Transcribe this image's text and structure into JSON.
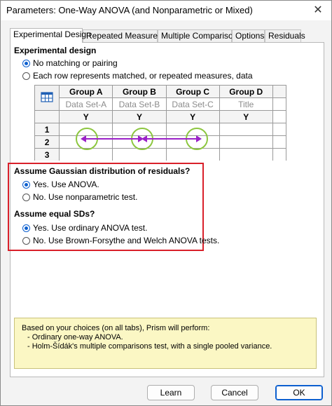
{
  "window": {
    "title": "Parameters: One-Way ANOVA (and Nonparametric or Mixed)"
  },
  "tabs": [
    {
      "label": "Experimental Design"
    },
    {
      "label": "Repeated Measures"
    },
    {
      "label": "Multiple Comparisons"
    },
    {
      "label": "Options"
    },
    {
      "label": "Residuals"
    }
  ],
  "experimental_design": {
    "heading": "Experimental design",
    "options": [
      {
        "label": "No matching or pairing",
        "selected": true
      },
      {
        "label": "Each row represents matched, or repeated measures, data",
        "selected": false
      }
    ]
  },
  "preview_table": {
    "groups": [
      "Group A",
      "Group B",
      "Group C",
      "Group D"
    ],
    "titles": [
      "Data Set-A",
      "Data Set-B",
      "Data Set-C",
      "Title"
    ],
    "y_labels": [
      "Y",
      "Y",
      "Y",
      "Y"
    ],
    "rows": [
      "1",
      "2",
      "3"
    ]
  },
  "gaussian": {
    "heading": "Assume Gaussian distribution of residuals?",
    "options": [
      {
        "label": "Yes. Use ANOVA.",
        "selected": true
      },
      {
        "label": "No. Use nonparametric test.",
        "selected": false
      }
    ]
  },
  "equal_sds": {
    "heading": "Assume equal SDs?",
    "options": [
      {
        "label": "Yes. Use ordinary ANOVA test.",
        "selected": true
      },
      {
        "label": "No. Use Brown-Forsythe and Welch ANOVA tests.",
        "selected": false
      }
    ]
  },
  "summary": {
    "intro": "Based on your choices (on all tabs), Prism will perform:",
    "items": [
      "- Ordinary one-way ANOVA.",
      "- Holm-Šídák's multiple comparisons test, with a single pooled variance."
    ]
  },
  "buttons": {
    "learn": "Learn",
    "cancel": "Cancel",
    "ok": "OK"
  },
  "colors": {
    "accent": "#0c5fcf",
    "highlight_box": "#d9202a",
    "arrow": "#9b21c8",
    "circle": "#8cc63f",
    "info_bg": "#fbf7c4"
  }
}
